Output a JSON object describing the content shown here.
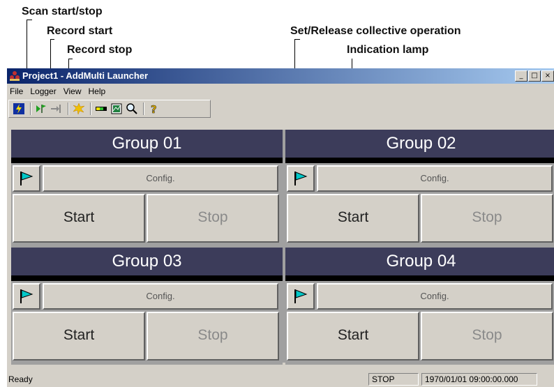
{
  "callouts": {
    "scan": "Scan start/stop",
    "record_start": "Record start",
    "record_stop": "Record stop",
    "collective": "Set/Release collective operation",
    "lamp": "Indication lamp"
  },
  "window": {
    "title": "Project1 - AddMulti Launcher",
    "controls": {
      "minimize": "_",
      "maximize": "□",
      "close": "×"
    }
  },
  "menu": [
    "File",
    "Logger",
    "View",
    "Help"
  ],
  "toolbar": [
    "scan-start-stop-icon",
    "record-start-icon",
    "record-stop-icon",
    "burst-icon",
    "level-meter-icon",
    "display-icon",
    "zoom-icon",
    "help-icon"
  ],
  "groups": [
    {
      "title": "Group 01",
      "config": "Config.",
      "start": "Start",
      "stop": "Stop"
    },
    {
      "title": "Group 02",
      "config": "Config.",
      "start": "Start",
      "stop": "Stop"
    },
    {
      "title": "Group 03",
      "config": "Config.",
      "start": "Start",
      "stop": "Stop"
    },
    {
      "title": "Group 04",
      "config": "Config.",
      "start": "Start",
      "stop": "Stop"
    }
  ],
  "status": {
    "ready": "Ready",
    "state": "STOP",
    "datetime": "1970/01/01 09:00:00.000"
  },
  "colors": {
    "group_header": "#3c3c5a",
    "title_bar_start": "#0a246a",
    "flag": "#00c8c8"
  }
}
